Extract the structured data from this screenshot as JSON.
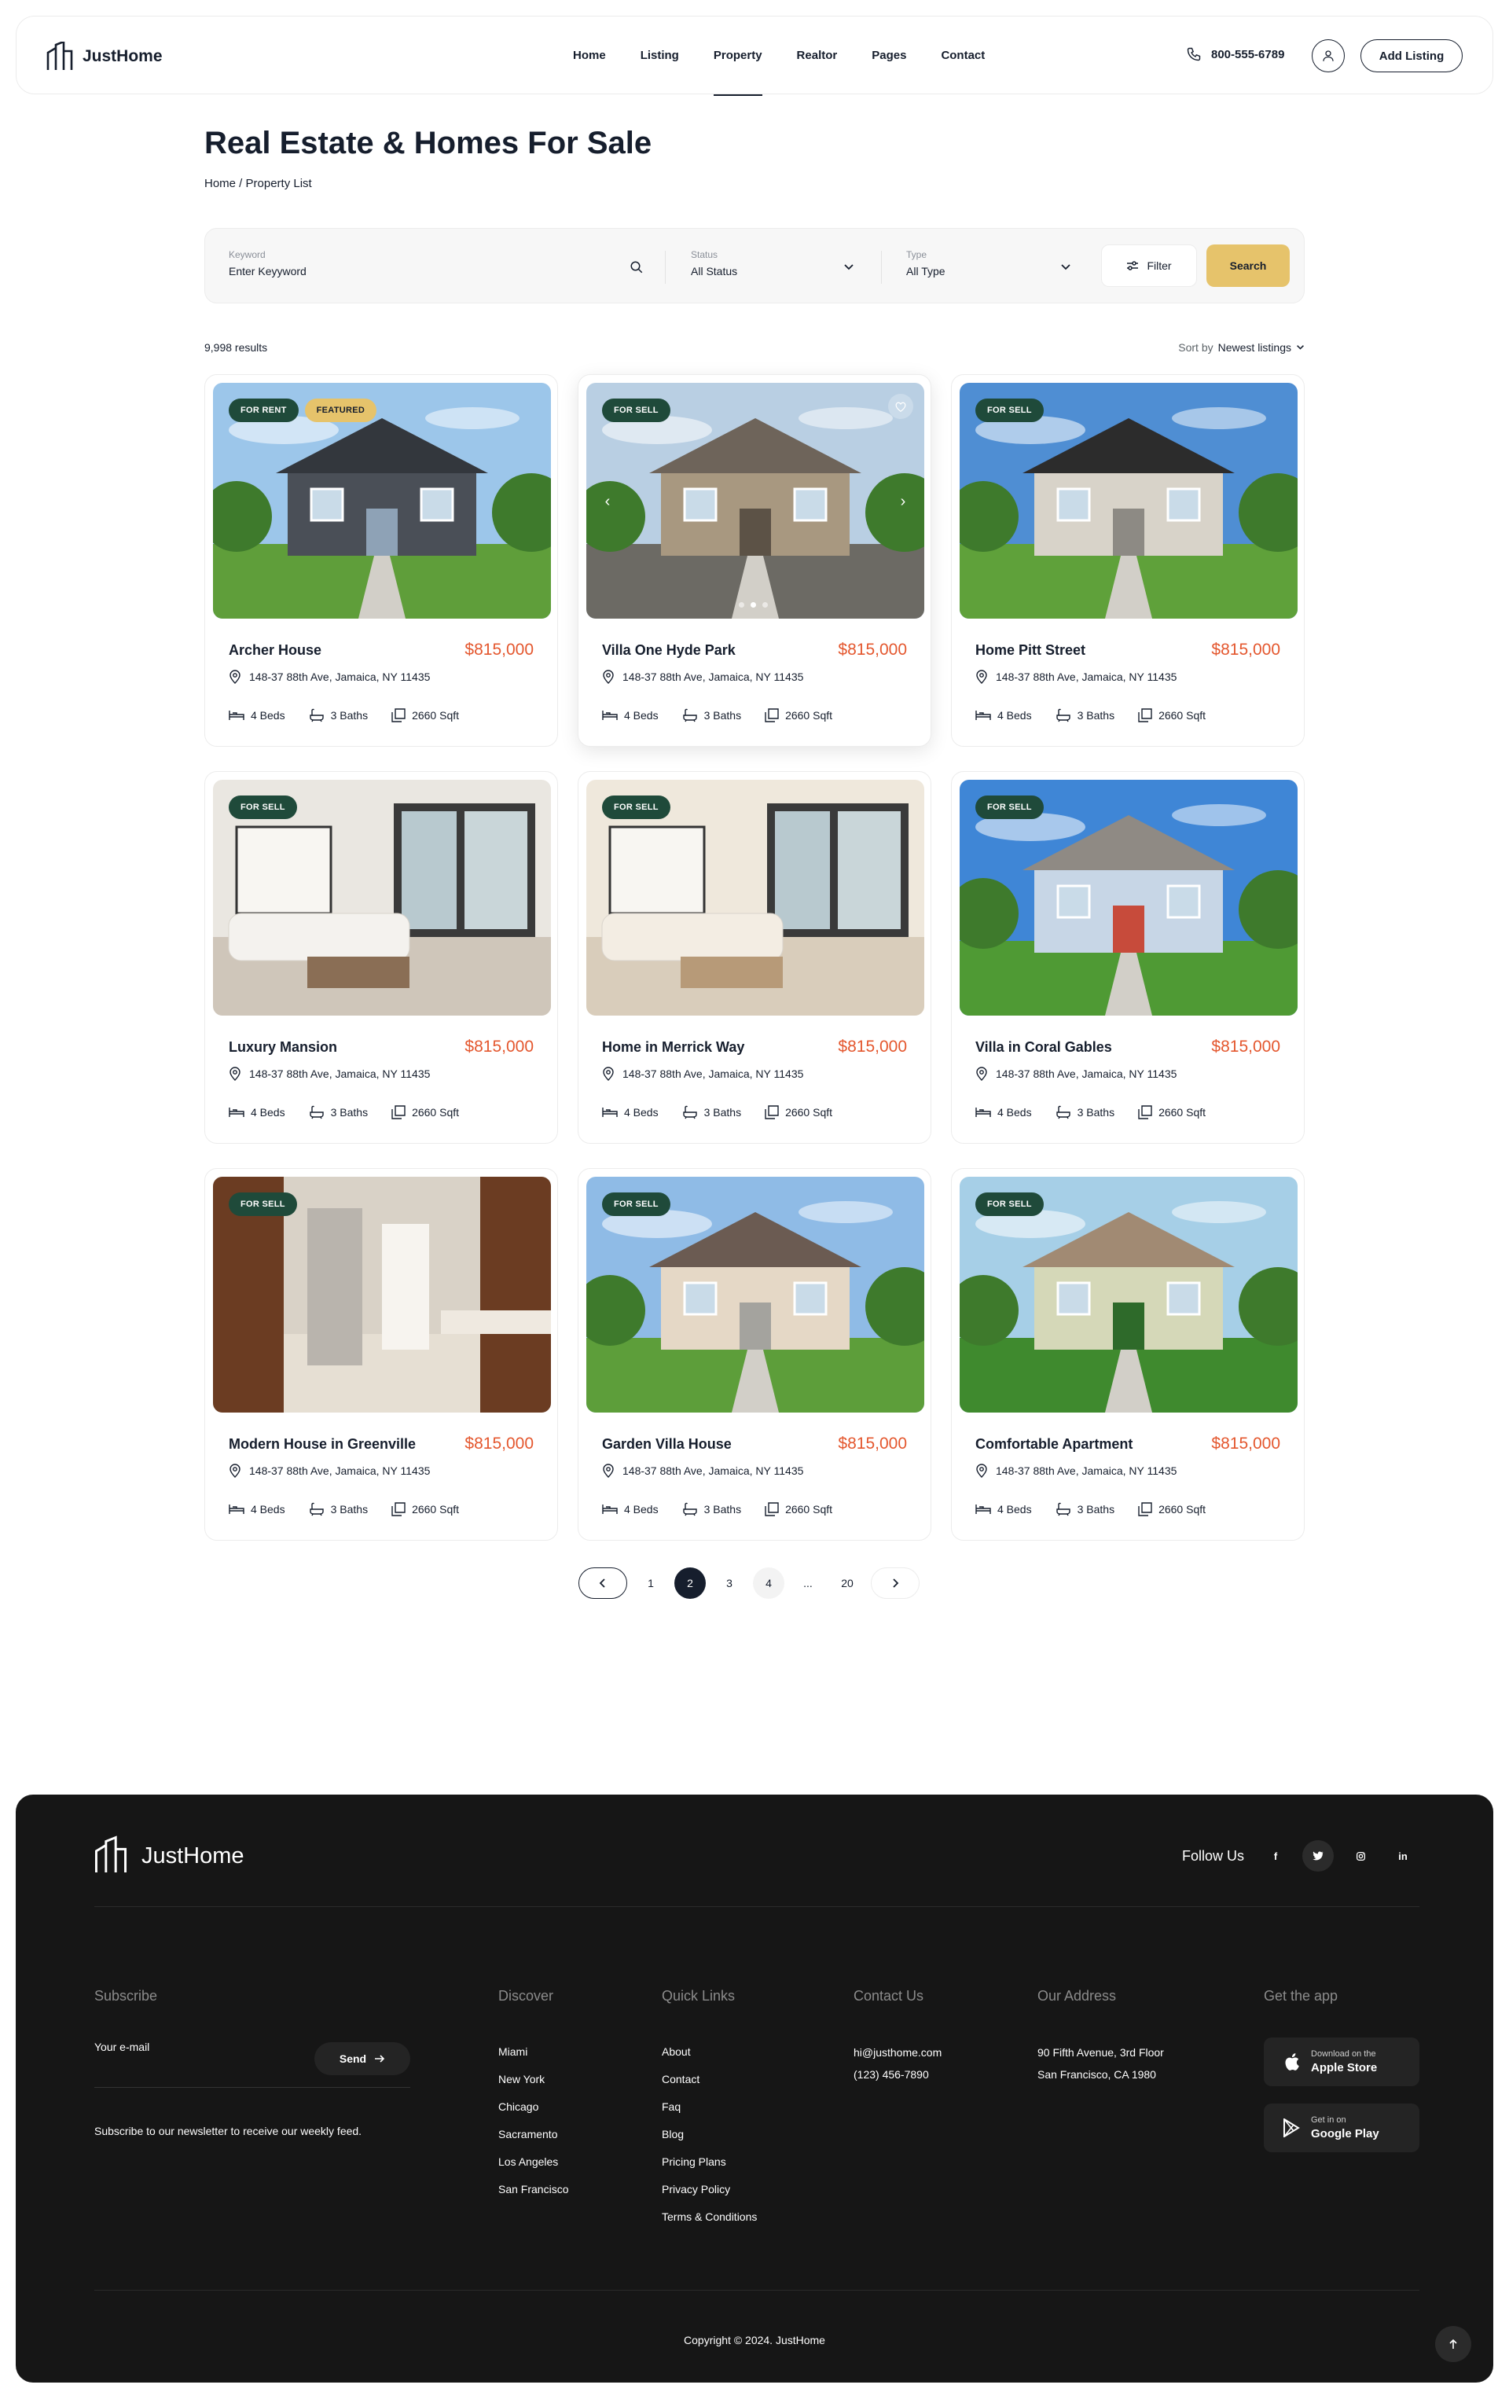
{
  "header": {
    "brand": "JustHome",
    "nav": [
      "Home",
      "Listing",
      "Property",
      "Realtor",
      "Pages",
      "Contact"
    ],
    "active_nav": "Property",
    "phone": "800-555-6789",
    "add_listing": "Add Listing"
  },
  "page": {
    "title": "Real Estate & Homes For Sale",
    "breadcrumb": "Home / Property List"
  },
  "search": {
    "keyword_label": "Keyword",
    "keyword_placeholder": "Enter Keyyword",
    "status_label": "Status",
    "status_value": "All Status",
    "type_label": "Type",
    "type_value": "All Type",
    "filter": "Filter",
    "search": "Search"
  },
  "results": {
    "count": "9,998 results",
    "sort_label": "Sort by",
    "sort_value": "Newest listings"
  },
  "listings": [
    {
      "title": "Archer House",
      "price": "$815,000",
      "address": "148-37 88th Ave, Jamaica, NY 11435",
      "beds": "4 Beds",
      "baths": "3 Baths",
      "sqft": "2660 Sqft",
      "badges": [
        "FOR RENT",
        "FEATURED"
      ]
    },
    {
      "title": "Villa One Hyde Park",
      "price": "$815,000",
      "address": "148-37 88th Ave, Jamaica, NY 11435",
      "beds": "4 Beds",
      "baths": "3 Baths",
      "sqft": "2660 Sqft",
      "badges": [
        "FOR SELL"
      ]
    },
    {
      "title": "Home Pitt Street",
      "price": "$815,000",
      "address": "148-37 88th Ave, Jamaica, NY 11435",
      "beds": "4 Beds",
      "baths": "3 Baths",
      "sqft": "2660 Sqft",
      "badges": [
        "FOR SELL"
      ]
    },
    {
      "title": "Luxury Mansion",
      "price": "$815,000",
      "address": "148-37 88th Ave, Jamaica, NY 11435",
      "beds": "4 Beds",
      "baths": "3 Baths",
      "sqft": "2660 Sqft",
      "badges": [
        "FOR SELL"
      ]
    },
    {
      "title": "Home in Merrick Way",
      "price": "$815,000",
      "address": "148-37 88th Ave, Jamaica, NY 11435",
      "beds": "4 Beds",
      "baths": "3 Baths",
      "sqft": "2660 Sqft",
      "badges": [
        "FOR SELL"
      ]
    },
    {
      "title": "Villa in Coral Gables",
      "price": "$815,000",
      "address": "148-37 88th Ave, Jamaica, NY 11435",
      "beds": "4 Beds",
      "baths": "3 Baths",
      "sqft": "2660 Sqft",
      "badges": [
        "FOR SELL"
      ]
    },
    {
      "title": "Modern House in Greenville",
      "price": "$815,000",
      "address": "148-37 88th Ave, Jamaica, NY 11435",
      "beds": "4 Beds",
      "baths": "3 Baths",
      "sqft": "2660 Sqft",
      "badges": [
        "FOR SELL"
      ]
    },
    {
      "title": "Garden Villa House",
      "price": "$815,000",
      "address": "148-37 88th Ave, Jamaica, NY 11435",
      "beds": "4 Beds",
      "baths": "3 Baths",
      "sqft": "2660 Sqft",
      "badges": [
        "FOR SELL"
      ]
    },
    {
      "title": "Comfortable Apartment",
      "price": "$815,000",
      "address": "148-37 88th Ave, Jamaica, NY 11435",
      "beds": "4 Beds",
      "baths": "3 Baths",
      "sqft": "2660 Sqft",
      "badges": [
        "FOR SELL"
      ]
    }
  ],
  "pagination": {
    "pages": [
      "1",
      "2",
      "3",
      "4",
      "...",
      "20"
    ],
    "current": "2"
  },
  "footer": {
    "brand": "JustHome",
    "follow_label": "Follow Us",
    "social": [
      "f",
      "twitter",
      "instagram",
      "in"
    ],
    "subscribe_head": "Subscribe",
    "email_placeholder": "Your e-mail",
    "send": "Send",
    "subscribe_text": "Subscribe to our newsletter to receive our weekly feed.",
    "discover_head": "Discover",
    "discover": [
      "Miami",
      "New York",
      "Chicago",
      "Sacramento",
      "Los Angeles",
      "San Francisco"
    ],
    "quick_head": "Quick Links",
    "quick": [
      "About",
      "Contact",
      "Faq",
      "Blog",
      "Pricing Plans",
      "Privacy Policy",
      "Terms & Conditions"
    ],
    "contact_head": "Contact Us",
    "contact": [
      "hi@justhome.com",
      "(123) 456-7890"
    ],
    "address_head": "Our Address",
    "address": [
      "90 Fifth Avenue, 3rd Floor",
      "San Francisco, CA 1980"
    ],
    "app_head": "Get the app",
    "apple_small": "Download on the",
    "apple_big": "Apple Store",
    "google_small": "Get in on",
    "google_big": "Google Play",
    "copyright": "Copyright © 2024. JustHome"
  },
  "colors": {
    "accent": "#e6c36b",
    "price": "#e4572e",
    "badge": "#1f4a3a",
    "footer_bg": "#161616"
  }
}
